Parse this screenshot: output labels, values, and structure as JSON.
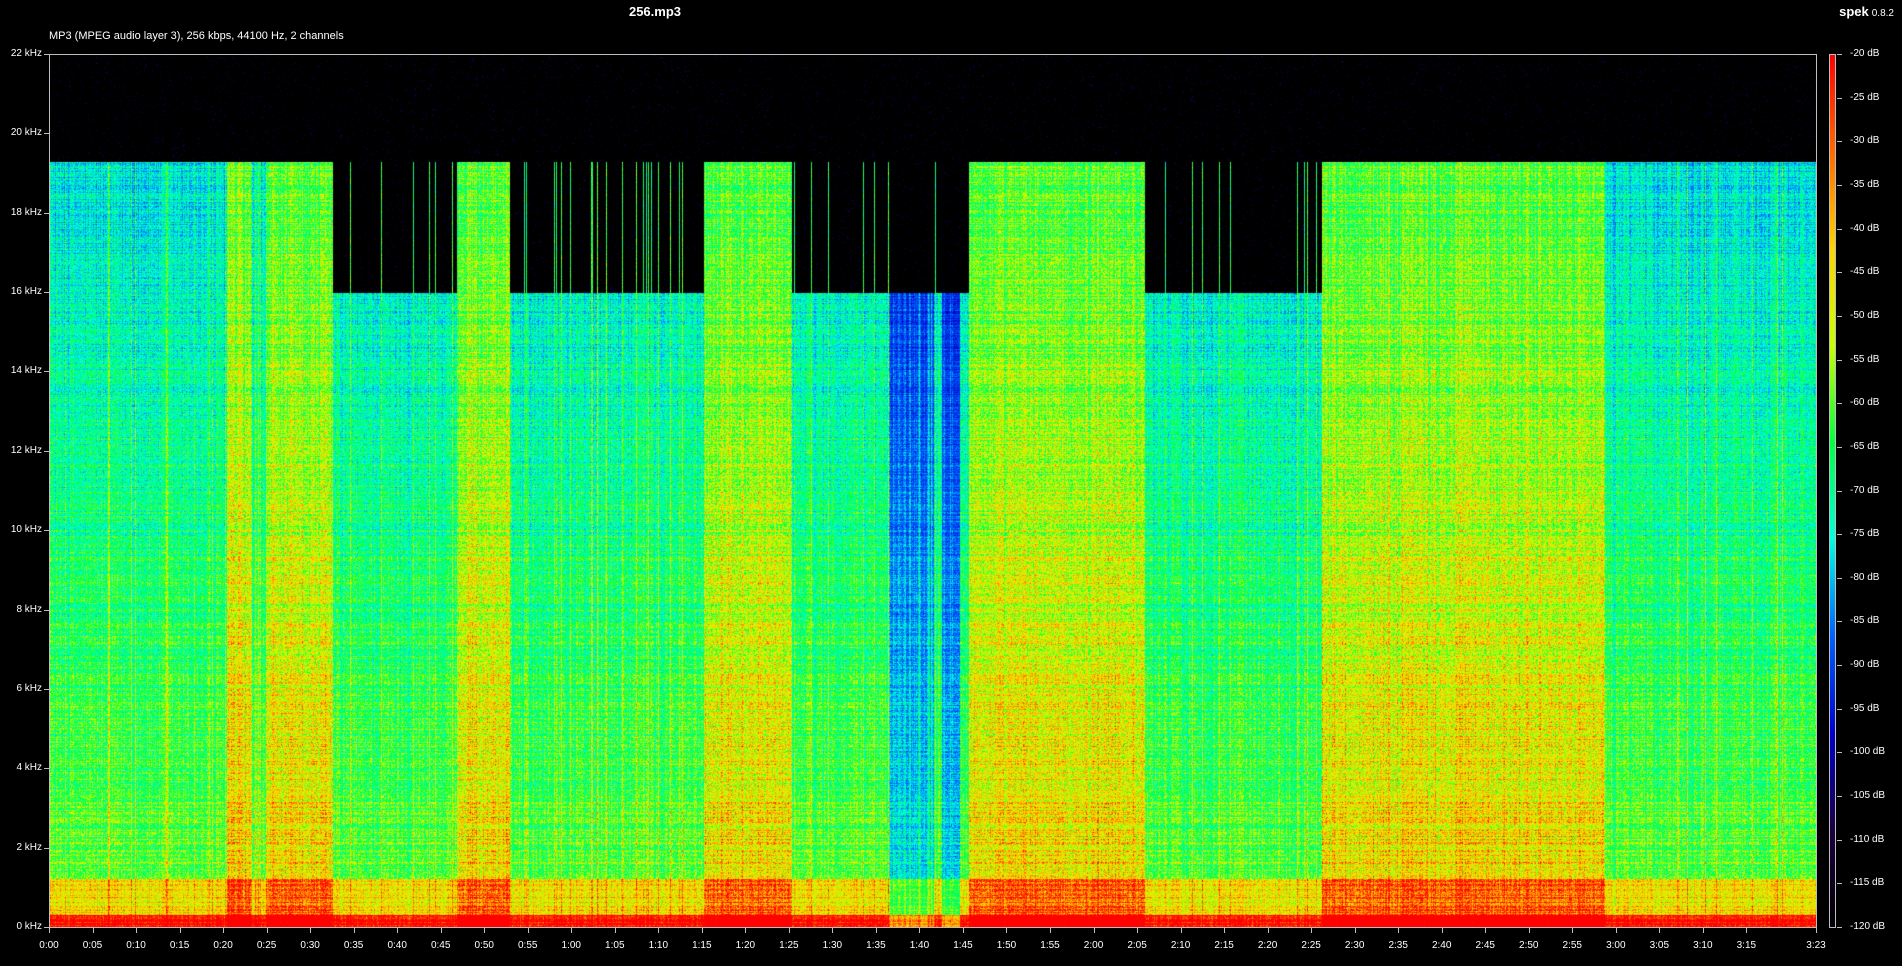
{
  "window": {
    "file_title": "256.mp3",
    "app_name": "spek",
    "app_version": "0.8.2",
    "info_line": "MP3 (MPEG audio layer 3), 256 kbps, 44100 Hz, 2 channels"
  },
  "freq_axis": {
    "unit": "kHz",
    "ticks": [
      "22 kHz",
      "20 kHz",
      "18 kHz",
      "16 kHz",
      "14 kHz",
      "12 kHz",
      "10 kHz",
      "8 kHz",
      "6 kHz",
      "4 kHz",
      "2 kHz",
      "0 kHz"
    ]
  },
  "time_axis": {
    "ticks": [
      "0:00",
      "0:05",
      "0:10",
      "0:15",
      "0:20",
      "0:25",
      "0:30",
      "0:35",
      "0:40",
      "0:45",
      "0:50",
      "0:55",
      "1:00",
      "1:05",
      "1:10",
      "1:15",
      "1:20",
      "1:25",
      "1:30",
      "1:35",
      "1:40",
      "1:45",
      "1:50",
      "1:55",
      "2:00",
      "2:05",
      "2:10",
      "2:15",
      "2:20",
      "2:25",
      "2:30",
      "2:35",
      "2:40",
      "2:45",
      "2:50",
      "2:55",
      "3:00",
      "3:05",
      "3:10",
      "3:15",
      "3:23"
    ],
    "duration": "3:23"
  },
  "db_scale": {
    "ticks": [
      "-20 dB",
      "-25 dB",
      "-30 dB",
      "-35 dB",
      "-40 dB",
      "-45 dB",
      "-50 dB",
      "-55 dB",
      "-60 dB",
      "-65 dB",
      "-70 dB",
      "-75 dB",
      "-80 dB",
      "-85 dB",
      "-90 dB",
      "-95 dB",
      "-100 dB",
      "-105 dB",
      "-110 dB",
      "-115 dB",
      "-120 dB"
    ],
    "colors": [
      "#ff0000",
      "#ff6a00",
      "#ffd400",
      "#c8ff00",
      "#00ff40",
      "#00ffe0",
      "#0060ff",
      "#0000c8",
      "#1a0040",
      "#000000"
    ]
  },
  "colors": {
    "background": "#000000",
    "axis": "#bdbdbd",
    "text": "#ffffff"
  }
}
